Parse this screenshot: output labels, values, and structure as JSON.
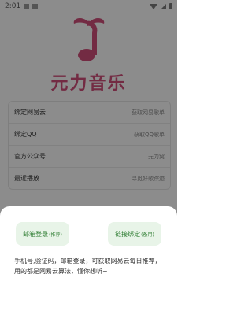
{
  "status_bar": {
    "time": "2:01"
  },
  "app": {
    "title": "元力音乐"
  },
  "settings": [
    {
      "label": "绑定网易云",
      "value": "获取网易歌单"
    },
    {
      "label": "绑定QQ",
      "value": "获取QQ歌单"
    },
    {
      "label": "官方公众号",
      "value": "元力窝"
    },
    {
      "label": "最近播放",
      "value": "寻觅好歌踪迹"
    }
  ],
  "bottom_sheet": {
    "email_login": {
      "label": "邮箱登录",
      "tag": "(推荐)"
    },
    "link_bind": {
      "label": "链接绑定",
      "tag": "(备用)"
    },
    "description": "手机号,验证码，邮箱登录，可获取网易云每日推荐，用的都是网易云算法，懂你想听~"
  },
  "colors": {
    "brand": "#d14f7a",
    "button_bg": "#e8f4e8",
    "button_text": "#2e7d32"
  }
}
